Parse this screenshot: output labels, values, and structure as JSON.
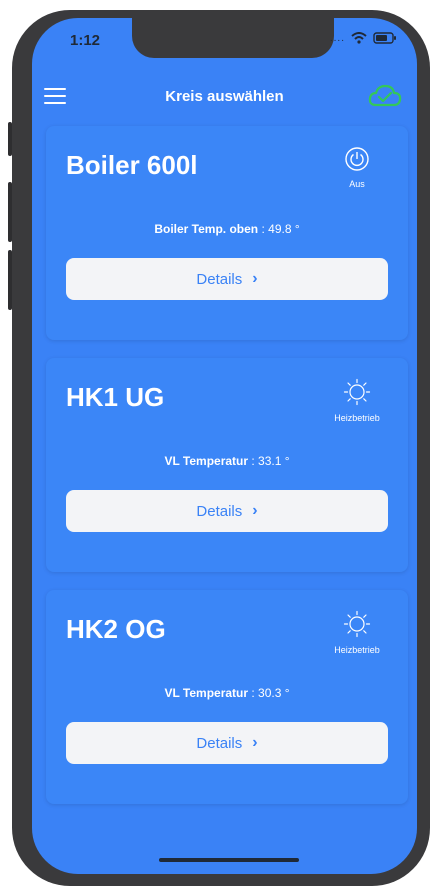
{
  "status_bar": {
    "time": "1:12"
  },
  "header": {
    "title": "Kreis auswählen"
  },
  "cards": [
    {
      "title": "Boiler 600l",
      "state": "Aus",
      "icon": "power-icon",
      "reading_label": "Boiler Temp. oben",
      "reading_value": " : 49.8 °",
      "button": "Details"
    },
    {
      "title": "HK1 UG",
      "state": "Heizbetrieb",
      "icon": "sun-icon",
      "reading_label": "VL Temperatur",
      "reading_value": " : 33.1 °",
      "button": "Details"
    },
    {
      "title": "HK2 OG",
      "state": "Heizbetrieb",
      "icon": "sun-icon",
      "reading_label": "VL Temperatur",
      "reading_value": " : 30.3 °",
      "button": "Details"
    }
  ],
  "colors": {
    "background": "#3a82f6",
    "cloud": "#34c759",
    "button_bg": "#f3f4f7"
  }
}
